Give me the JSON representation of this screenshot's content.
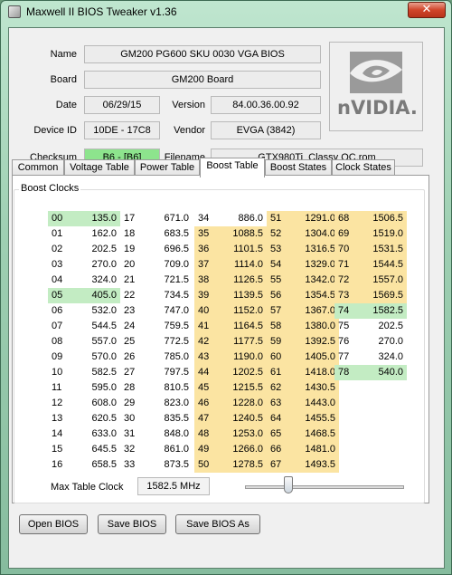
{
  "window": {
    "title": "Maxwell II BIOS Tweaker v1.36",
    "close_glyph": "✕",
    "app_icon": "app-icon"
  },
  "info": {
    "name_label": "Name",
    "name": "GM200 PG600 SKU 0030 VGA BIOS",
    "board_label": "Board",
    "board": "GM200 Board",
    "date_label": "Date",
    "date": "06/29/15",
    "version_label": "Version",
    "version": "84.00.36.00.92",
    "device_id_label": "Device ID",
    "device_id": "10DE - 17C8",
    "vendor_label": "Vendor",
    "vendor": "EVGA (3842)",
    "checksum_label": "Checksum",
    "checksum": "B6 - [B6]",
    "filename_label": "Filename",
    "filename": "GTX980Ti_Classy OC.rom",
    "logo_text": "nVIDIA.",
    "checksum_color": "#8de48d"
  },
  "tabs": [
    {
      "label": "Common",
      "active": false
    },
    {
      "label": "Voltage Table",
      "active": false
    },
    {
      "label": "Power Table",
      "active": false
    },
    {
      "label": "Boost Table",
      "active": true
    },
    {
      "label": "Boost States",
      "active": false
    },
    {
      "label": "Clock States",
      "active": false
    }
  ],
  "boost": {
    "group_title": "Boost Clocks",
    "colors": {
      "yellow": "#fbe4a2",
      "green": "#c3ecc3"
    },
    "columns": [
      [
        [
          "00",
          "135.0",
          "green"
        ],
        [
          "01",
          "162.0",
          ""
        ],
        [
          "02",
          "202.5",
          ""
        ],
        [
          "03",
          "270.0",
          ""
        ],
        [
          "04",
          "324.0",
          ""
        ],
        [
          "05",
          "405.0",
          "green"
        ],
        [
          "06",
          "532.0",
          ""
        ],
        [
          "07",
          "544.5",
          ""
        ],
        [
          "08",
          "557.0",
          ""
        ],
        [
          "09",
          "570.0",
          ""
        ],
        [
          "10",
          "582.5",
          ""
        ],
        [
          "11",
          "595.0",
          ""
        ],
        [
          "12",
          "608.0",
          ""
        ],
        [
          "13",
          "620.5",
          ""
        ],
        [
          "14",
          "633.0",
          ""
        ],
        [
          "15",
          "645.5",
          ""
        ],
        [
          "16",
          "658.5",
          ""
        ]
      ],
      [
        [
          "17",
          "671.0",
          ""
        ],
        [
          "18",
          "683.5",
          ""
        ],
        [
          "19",
          "696.5",
          ""
        ],
        [
          "20",
          "709.0",
          ""
        ],
        [
          "21",
          "721.5",
          ""
        ],
        [
          "22",
          "734.5",
          ""
        ],
        [
          "23",
          "747.0",
          ""
        ],
        [
          "24",
          "759.5",
          ""
        ],
        [
          "25",
          "772.5",
          ""
        ],
        [
          "26",
          "785.0",
          ""
        ],
        [
          "27",
          "797.5",
          ""
        ],
        [
          "28",
          "810.5",
          ""
        ],
        [
          "29",
          "823.0",
          ""
        ],
        [
          "30",
          "835.5",
          ""
        ],
        [
          "31",
          "848.0",
          ""
        ],
        [
          "32",
          "861.0",
          ""
        ],
        [
          "33",
          "873.5",
          ""
        ]
      ],
      [
        [
          "34",
          "886.0",
          ""
        ],
        [
          "35",
          "1088.5",
          "yellow"
        ],
        [
          "36",
          "1101.5",
          "yellow"
        ],
        [
          "37",
          "1114.0",
          "yellow"
        ],
        [
          "38",
          "1126.5",
          "yellow"
        ],
        [
          "39",
          "1139.5",
          "yellow"
        ],
        [
          "40",
          "1152.0",
          "yellow"
        ],
        [
          "41",
          "1164.5",
          "yellow"
        ],
        [
          "42",
          "1177.5",
          "yellow"
        ],
        [
          "43",
          "1190.0",
          "yellow"
        ],
        [
          "44",
          "1202.5",
          "yellow"
        ],
        [
          "45",
          "1215.5",
          "yellow"
        ],
        [
          "46",
          "1228.0",
          "yellow"
        ],
        [
          "47",
          "1240.5",
          "yellow"
        ],
        [
          "48",
          "1253.0",
          "yellow"
        ],
        [
          "49",
          "1266.0",
          "yellow"
        ],
        [
          "50",
          "1278.5",
          "yellow"
        ]
      ],
      [
        [
          "51",
          "1291.0",
          "yellow"
        ],
        [
          "52",
          "1304.0",
          "yellow"
        ],
        [
          "53",
          "1316.5",
          "yellow"
        ],
        [
          "54",
          "1329.0",
          "yellow"
        ],
        [
          "55",
          "1342.0",
          "yellow"
        ],
        [
          "56",
          "1354.5",
          "yellow"
        ],
        [
          "57",
          "1367.0",
          "yellow"
        ],
        [
          "58",
          "1380.0",
          "yellow"
        ],
        [
          "59",
          "1392.5",
          "yellow"
        ],
        [
          "60",
          "1405.0",
          "yellow"
        ],
        [
          "61",
          "1418.0",
          "yellow"
        ],
        [
          "62",
          "1430.5",
          "yellow"
        ],
        [
          "63",
          "1443.0",
          "yellow"
        ],
        [
          "64",
          "1455.5",
          "yellow"
        ],
        [
          "65",
          "1468.5",
          "yellow"
        ],
        [
          "66",
          "1481.0",
          "yellow"
        ],
        [
          "67",
          "1493.5",
          "yellow"
        ]
      ],
      [
        [
          "68",
          "1506.5",
          "yellow"
        ],
        [
          "69",
          "1519.0",
          "yellow"
        ],
        [
          "70",
          "1531.5",
          "yellow"
        ],
        [
          "71",
          "1544.5",
          "yellow"
        ],
        [
          "72",
          "1557.0",
          "yellow"
        ],
        [
          "73",
          "1569.5",
          "yellow"
        ],
        [
          "74",
          "1582.5",
          "green"
        ],
        [
          "75",
          "202.5",
          ""
        ],
        [
          "76",
          "270.0",
          ""
        ],
        [
          "77",
          "324.0",
          ""
        ],
        [
          "78",
          "540.0",
          "green"
        ]
      ]
    ],
    "max_clock_label": "Max Table Clock",
    "max_clock": "1582.5 MHz",
    "slider_fraction": 0.27
  },
  "buttons": {
    "open": "Open BIOS",
    "save": "Save BIOS",
    "save_as": "Save BIOS As"
  }
}
